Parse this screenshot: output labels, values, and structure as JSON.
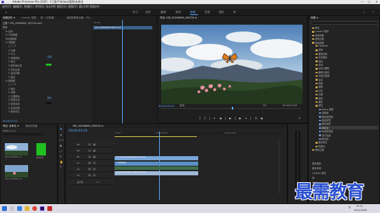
{
  "titlebar": {
    "title": "Adobe Premiere Pro 2020 - C:\\用户\\Video\\案例\\未命名",
    "minimize": "—",
    "maximize": "☐",
    "close": "✕"
  },
  "menu": [
    "文件(F)",
    "编辑(E)",
    "剪辑(C)",
    "序列(S)",
    "标记(M)",
    "图形(G)",
    "视图(V)",
    "窗口(W)",
    "帮助(H)"
  ],
  "workspaces": {
    "items": [
      "学习",
      "组件",
      "编辑",
      "颜色",
      "效果",
      "音频",
      "图形",
      "库"
    ],
    "active_index": 4
  },
  "effect_controls": {
    "tabs": [
      "效果控件 ≡",
      "Lumetri 范围",
      "源：(无剪辑)",
      "音频剪辑混合器：VID_..."
    ],
    "source_line": "主要 * VID_20200809_163334.mp4",
    "sequence_line": "VID_20200809_163334 * VID_...",
    "timecode_label": ":00:00",
    "clip_label": "VID_20200809161622.mp4",
    "sections": [
      {
        "label": "视频",
        "indent": 0
      },
      {
        "label": "fx 运动",
        "indent": 1
      },
      {
        "label": "fx 不透明度",
        "indent": 1
      },
      {
        "label": "时间重映射",
        "indent": 1
      },
      {
        "label": "fx 亮度键",
        "indent": 1
      },
      {
        "label": "◯ □ ✎",
        "indent": 2
      },
      {
        "label": "Ö 位置",
        "indent": 2
      },
      {
        "label": "Ö 中心",
        "indent": 2
      },
      {
        "label": "Ö 提取颜色",
        "indent": 2
      },
      {
        "label": "Ö 混合",
        "indent": 2
      },
      {
        "label": "Ö 颜色相似性",
        "indent": 2
      },
      {
        "label": "Ö 羽化边缘",
        "indent": 2
      },
      {
        "label": "Ö 溢出抑制",
        "indent": 2
      },
      {
        "label": "Ö 输出",
        "indent": 2
      },
      {
        "label": "fx 超级键",
        "indent": 1
      },
      {
        "label": "◯ □ ✎",
        "indent": 2
      },
      {
        "label": "Ö 输出",
        "indent": 2
      },
      {
        "label": "Ö 设置",
        "indent": 2
      },
      {
        "label": "Ö 主要颜色",
        "indent": 2
      },
      {
        "label": "Ö 遮罩生成",
        "indent": 2
      },
      {
        "label": "Ö 遮罩清除",
        "indent": 2
      },
      {
        "label": "Ö 溢出抑制",
        "indent": 2
      },
      {
        "label": "Ö 颜色校正",
        "indent": 2
      }
    ],
    "values": {
      "output": "合成",
      "setting": "默认"
    },
    "footer_timecode": "00;00;03;20"
  },
  "program": {
    "tab_label": "节目: VID_20200809_163334 ≡",
    "timecode": "00;00;03;20",
    "fit": "适合",
    "quality": "1/2",
    "duration": "00;00;07;02"
  },
  "effects_panel": {
    "tab": "效果 ≡",
    "items": [
      {
        "label": "预设",
        "depth": 0
      },
      {
        "label": "Lumetri 预设",
        "depth": 0
      },
      {
        "label": "音频效果",
        "depth": 0
      },
      {
        "label": "音频过渡",
        "depth": 0
      },
      {
        "label": "视频效果",
        "depth": 0
      },
      {
        "label": "Obsolete",
        "depth": 1
      },
      {
        "label": "变换",
        "depth": 1
      },
      {
        "label": "图像控制",
        "depth": 1
      },
      {
        "label": "实用程序",
        "depth": 1
      },
      {
        "label": "扭曲",
        "depth": 1
      },
      {
        "label": "时间",
        "depth": 1
      },
      {
        "label": "杂色与颗粒",
        "depth": 1
      },
      {
        "label": "模糊与锐化",
        "depth": 1
      },
      {
        "label": "沉浸式视频",
        "depth": 1
      },
      {
        "label": "生成",
        "depth": 1
      },
      {
        "label": "视频",
        "depth": 1
      },
      {
        "label": "调整",
        "depth": 1
      },
      {
        "label": "过时",
        "depth": 1
      },
      {
        "label": "过渡",
        "depth": 1
      },
      {
        "label": "透视",
        "depth": 1
      },
      {
        "label": "通道",
        "depth": 1
      },
      {
        "label": "键控",
        "depth": 1
      },
      {
        "label": "Alpha 调整",
        "depth": 2
      },
      {
        "label": "亮度键",
        "depth": 2
      },
      {
        "label": "图像遮罩键",
        "depth": 2
      },
      {
        "label": "差值遮罩",
        "depth": 2
      },
      {
        "label": "移除遮罩",
        "depth": 2
      },
      {
        "label": "超级键",
        "depth": 2
      },
      {
        "label": "轨道遮罩键",
        "depth": 2
      },
      {
        "label": "非红色键",
        "depth": 2
      },
      {
        "label": "颜色键",
        "depth": 2
      },
      {
        "label": "颜色校正",
        "depth": 1
      },
      {
        "label": "风格化",
        "depth": 1
      },
      {
        "label": "视频过渡",
        "depth": 0
      }
    ],
    "selected_index": 27,
    "bottom": [
      "基本图形",
      "基本声音",
      "Lumetri 颜色",
      "库",
      "标记"
    ]
  },
  "project": {
    "tabs": [
      "项目: 未命名 ≡",
      "媒体浏览器"
    ],
    "name": "未命名.prproj",
    "items": [
      {
        "name": "VID_20200809_16...",
        "dur": "7:02"
      },
      {
        "name": "颜色遮罩",
        "dur": "5:00"
      },
      {
        "name": "VID_20200809_16...",
        "dur": "7:02"
      }
    ]
  },
  "timeline": {
    "tab": "VID_20200809_163334 ≡",
    "timecode": "00;00;03;20",
    "ruler": [
      "00;00",
      "00;00;05;00",
      "00;00;10;00"
    ],
    "tracks": [
      {
        "label": "V3",
        "kind": "v"
      },
      {
        "label": "V2",
        "kind": "v"
      },
      {
        "label": "V1",
        "kind": "v"
      },
      {
        "label": "A1",
        "kind": "a"
      },
      {
        "label": "A2",
        "kind": "a"
      },
      {
        "label": "A3",
        "kind": "a"
      },
      {
        "label": "主声道",
        "kind": "m"
      }
    ],
    "master_value": "0.0",
    "clips": [
      {
        "label": "fx VID_20200809161622.mp4 [V]",
        "track": 1,
        "color": "#7aa6d8"
      },
      {
        "label": "fx 颜色遮罩",
        "track": 2,
        "color": "#5b8fc4"
      },
      {
        "label": "fx VID_20200809_163334.mp4 [V]",
        "track": 2,
        "color": "#9fb9d8"
      }
    ]
  },
  "taskbar": {
    "time": "19:12",
    "date": "2021/10/29",
    "lang": "中"
  },
  "watermark": "最需教育"
}
